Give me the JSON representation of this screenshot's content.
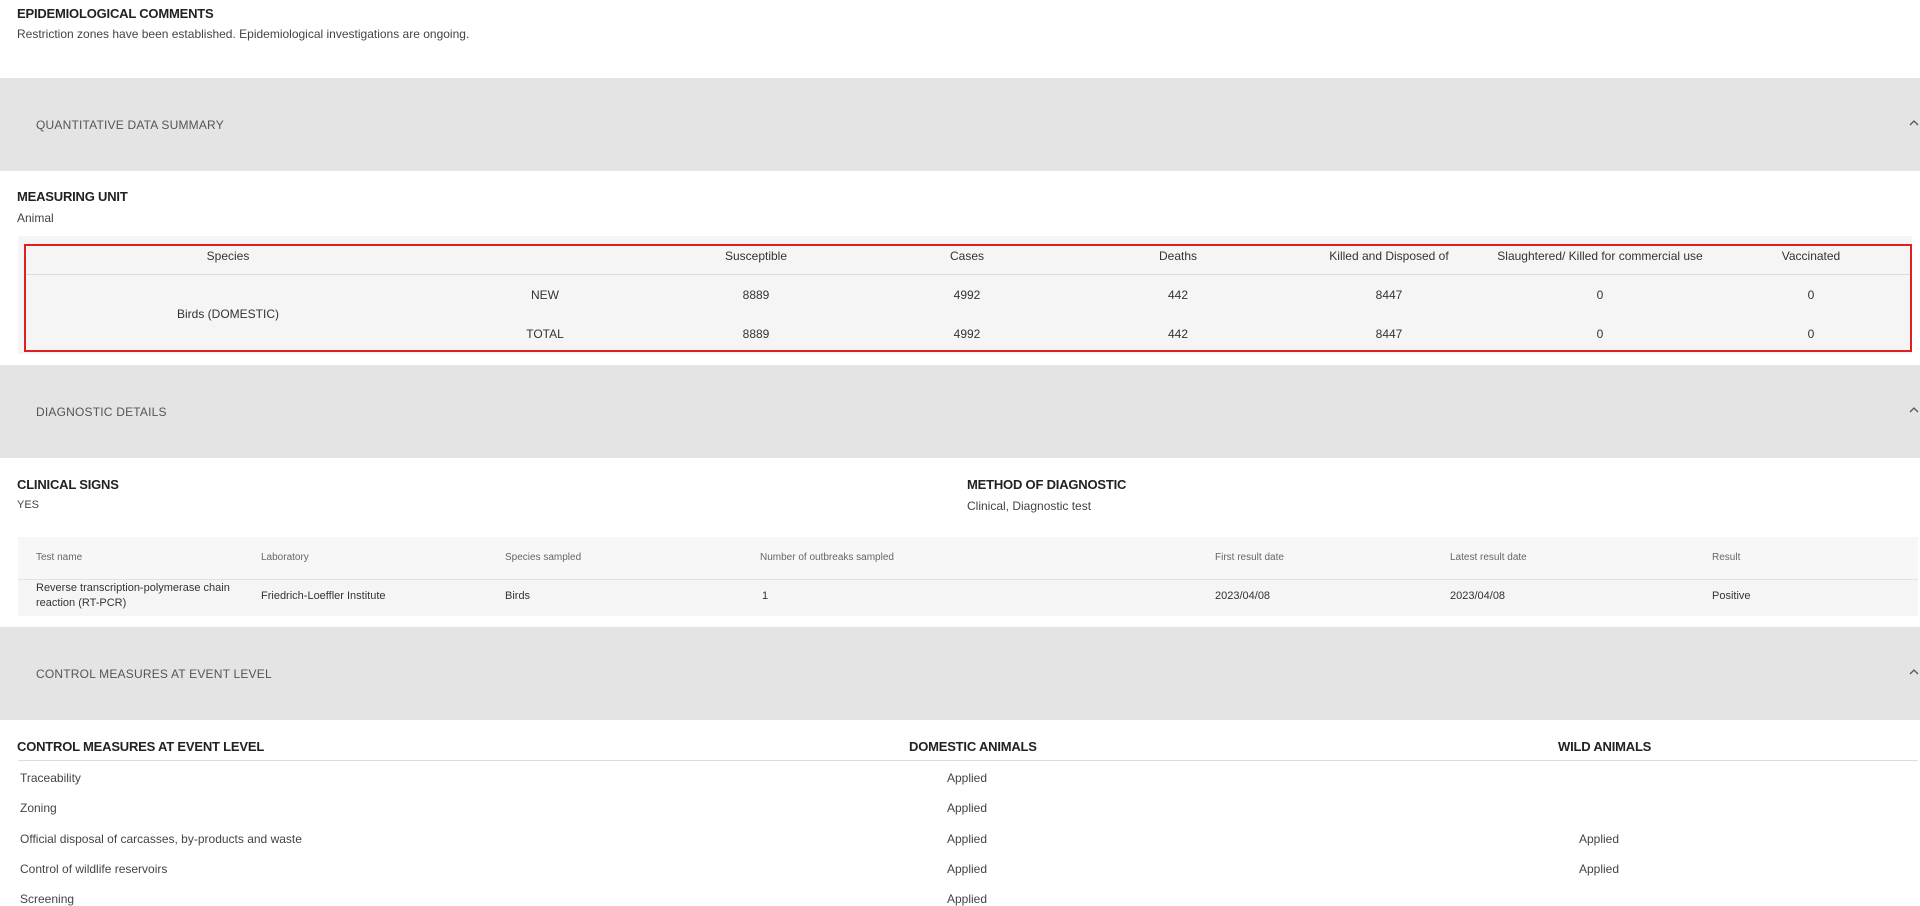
{
  "epidemiological": {
    "title": "EPIDEMIOLOGICAL COMMENTS",
    "text": "Restriction zones have been established. Epidemiological investigations are ongoing."
  },
  "sections": {
    "quantitative": "QUANTITATIVE DATA SUMMARY",
    "diagnostic": "DIAGNOSTIC DETAILS",
    "control": "CONTROL MEASURES AT EVENT LEVEL"
  },
  "measuring_unit": {
    "title": "MEASURING UNIT",
    "value": "Animal"
  },
  "quant_table": {
    "headers": [
      "Species",
      "Susceptible",
      "Cases",
      "Deaths",
      "Killed and Disposed of",
      "Slaughtered/ Killed for commercial use",
      "Vaccinated"
    ],
    "species": "Birds (DOMESTIC)",
    "rows": [
      {
        "type": "NEW",
        "values": [
          "8889",
          "4992",
          "442",
          "8447",
          "0",
          "0"
        ]
      },
      {
        "type": "TOTAL",
        "values": [
          "8889",
          "4992",
          "442",
          "8447",
          "0",
          "0"
        ]
      }
    ]
  },
  "clinical_signs": {
    "title": "CLINICAL SIGNS",
    "value": "YES"
  },
  "method_of_diagnostic": {
    "title": "METHOD OF DIAGNOSTIC",
    "value": "Clinical, Diagnostic test"
  },
  "diag_table": {
    "headers": [
      "Test name",
      "Laboratory",
      "Species sampled",
      "Number of outbreaks sampled",
      "First result date",
      "Latest result date",
      "Result"
    ],
    "row": {
      "test_name_1": "Reverse transcription-polymerase chain",
      "test_name_2": "reaction (RT-PCR)",
      "laboratory": "Friedrich-Loeffler Institute",
      "species": "Birds",
      "outbreaks": "1",
      "first_date": "2023/04/08",
      "latest_date": "2023/04/08",
      "result": "Positive"
    }
  },
  "control_measures": {
    "col_headers": [
      "CONTROL MEASURES AT EVENT LEVEL",
      "DOMESTIC ANIMALS",
      "WILD ANIMALS"
    ],
    "items": [
      {
        "name": "Traceability",
        "domestic": "Applied",
        "wild": ""
      },
      {
        "name": "Zoning",
        "domestic": "Applied",
        "wild": ""
      },
      {
        "name": "Official disposal of carcasses, by-products and waste",
        "domestic": "Applied",
        "wild": "Applied"
      },
      {
        "name": "Control of wildlife reservoirs",
        "domestic": "Applied",
        "wild": "Applied"
      },
      {
        "name": "Screening",
        "domestic": "Applied",
        "wild": ""
      }
    ]
  },
  "colors": {
    "band": "#e4e4e4",
    "highlight_border": "#e02020"
  },
  "icons": {
    "collapse": "chevron-up-icon"
  }
}
